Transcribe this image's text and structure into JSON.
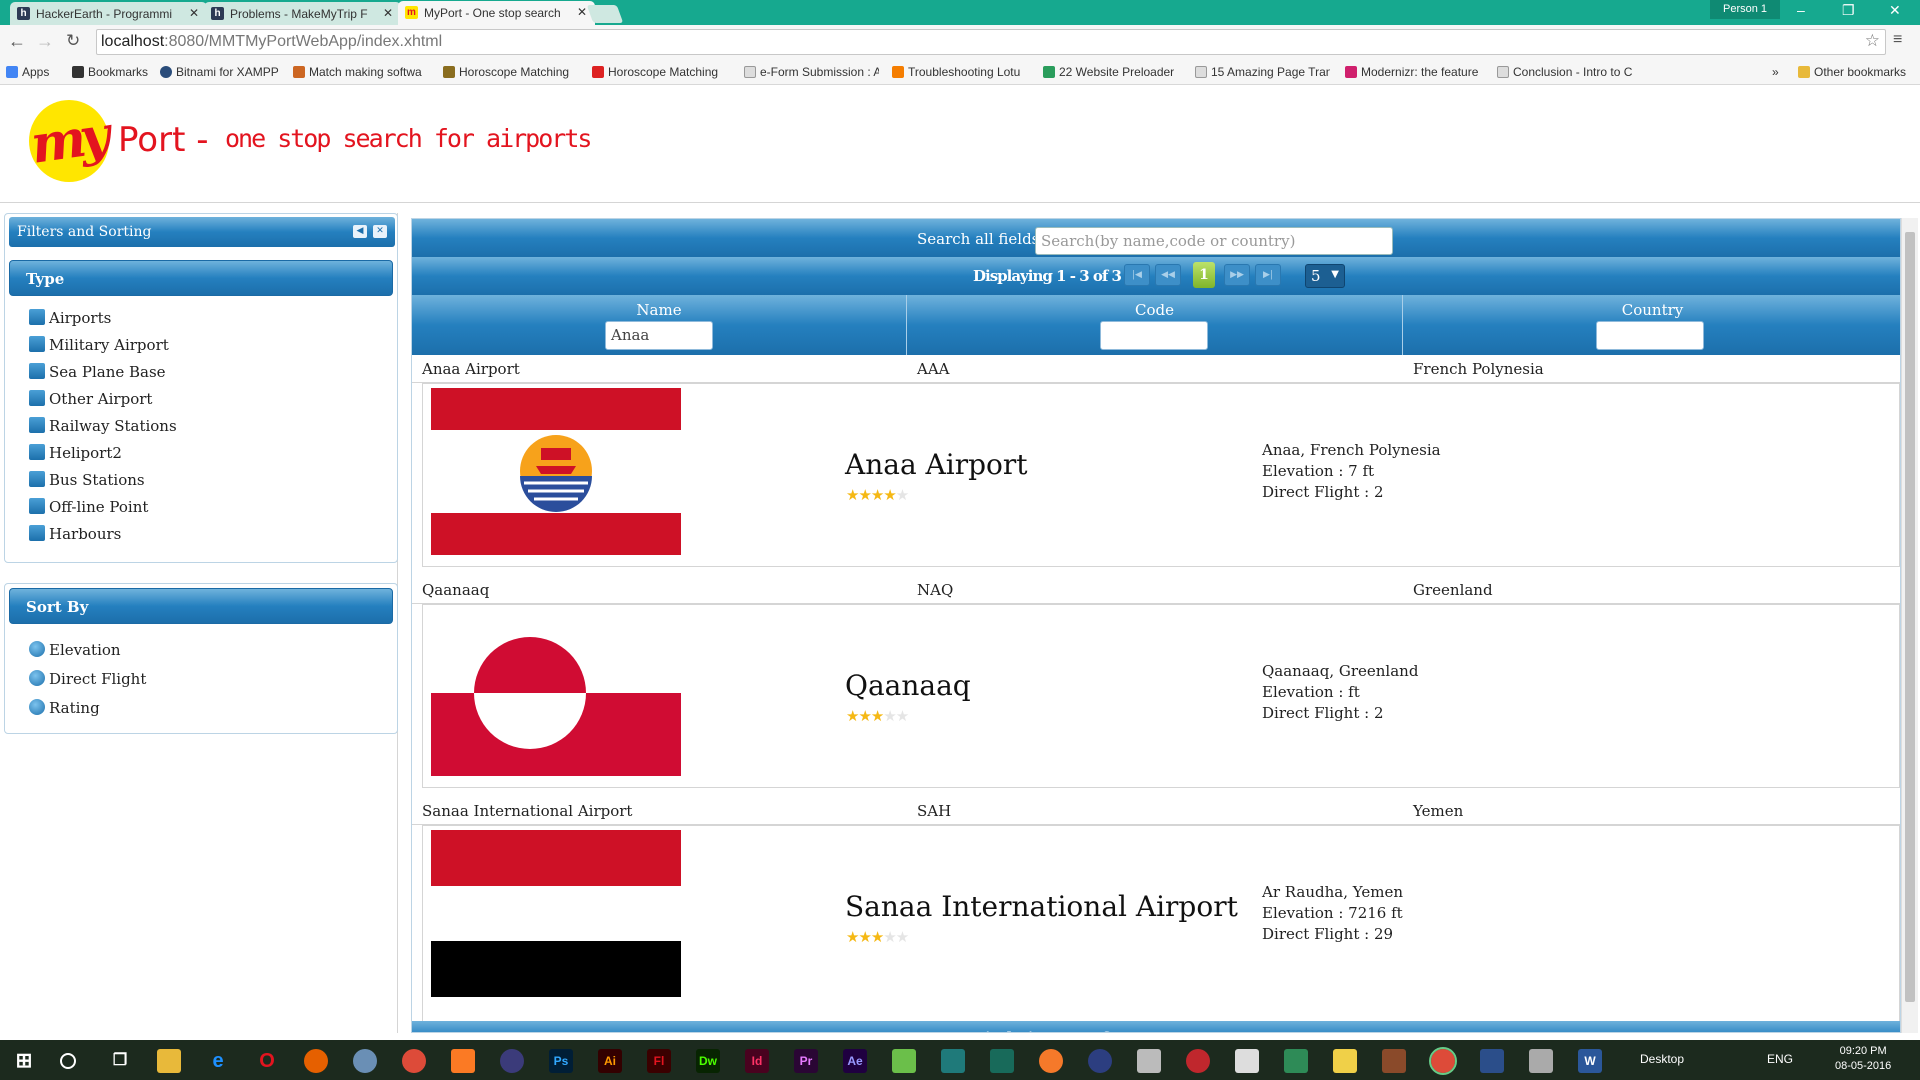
{
  "browser": {
    "tabs": [
      {
        "label": "HackerEarth - Programmi",
        "icon": "hackerearth-icon"
      },
      {
        "label": "Problems - MakeMyTrip F",
        "icon": "hackerearth-icon"
      },
      {
        "label": "MyPort - One stop search",
        "icon": "myport-icon"
      }
    ],
    "profile": "Person 1",
    "url_host": "localhost",
    "url_path": ":8080/MMTMyPortWebApp/index.xhtml",
    "bookmarks": [
      "Apps",
      "Bookmarks",
      "Bitnami for XAMPP",
      "Match making softwa",
      "Horoscope Matching",
      "Horoscope Matching",
      "e-Form Submission : A",
      "Troubleshooting Lotu",
      "22 Website Preloader",
      "15 Amazing Page Tran",
      "Modernizr: the feature",
      "Conclusion - Intro to C"
    ],
    "more_bookmarks": "»",
    "other_bookmarks": "Other bookmarks"
  },
  "site": {
    "logo_text": "my",
    "title": "Port -",
    "tagline": "one stop search for airports"
  },
  "sidebar": {
    "filters_title": "Filters and Sorting",
    "type_title": "Type",
    "types": [
      "Airports",
      "Military Airport",
      "Sea Plane Base",
      "Other Airport",
      "Railway Stations",
      "Heliport2",
      "Bus Stations",
      "Off-line Point",
      "Harbours"
    ],
    "sort_title": "Sort By",
    "sorts": [
      "Elevation",
      "Direct Flight",
      "Rating"
    ]
  },
  "table": {
    "search_label": "Search all fields :",
    "search_placeholder": "Search(by name,code or country)",
    "pager_text": "Displaying 1 - 3 of 3",
    "page_number": "1",
    "rows_per_page": "5",
    "columns": [
      "Name",
      "Code",
      "Country"
    ],
    "name_filter": "Anaa",
    "rows": [
      {
        "name": "Anaa Airport",
        "code": "AAA",
        "country": "French Polynesia",
        "title": "Anaa Airport",
        "rating": 4,
        "location": "Anaa, French Polynesia",
        "elevation": "Elevation : 7 ft",
        "direct": "Direct Flight : 2",
        "flag": "french-polynesia"
      },
      {
        "name": "Qaanaaq",
        "code": "NAQ",
        "country": "Greenland",
        "title": "Qaanaaq",
        "rating": 3,
        "location": "Qaanaaq, Greenland",
        "elevation": "Elevation : ft",
        "direct": "Direct Flight : 2",
        "flag": "greenland"
      },
      {
        "name": "Sanaa International Airport",
        "code": "SAH",
        "country": "Yemen",
        "title": "Sanaa International Airport",
        "rating": 3,
        "location": "Ar Raudha, Yemen",
        "elevation": "Elevation : 7216 ft",
        "direct": "Direct Flight : 29",
        "flag": "yemen"
      }
    ]
  },
  "taskbar": {
    "desktop": "Desktop",
    "lang": "ENG",
    "time": "09:20 PM",
    "date": "08-05-2016",
    "apps": [
      "Ps",
      "Ai",
      "Fl",
      "Dw",
      "Id",
      "Pr",
      "Ae"
    ]
  },
  "colors": {
    "accent": "#1c6fab",
    "brand_red": "#e3141f",
    "brand_yellow": "#ffe600",
    "tab_green": "#16a98f"
  }
}
